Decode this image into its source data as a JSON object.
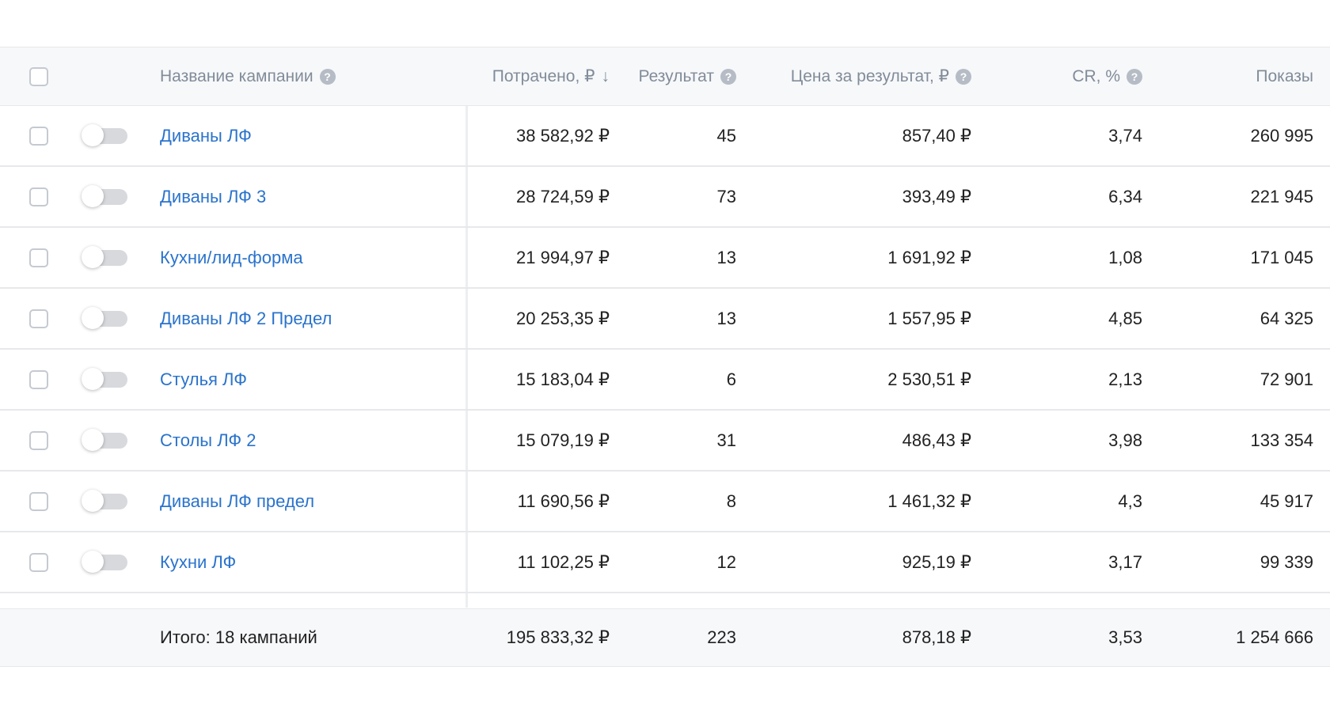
{
  "header": {
    "name": "Название кампании",
    "spent": "Потрачено, ₽",
    "result": "Результат",
    "price": "Цена за результат, ₽",
    "cr": "CR, %",
    "shows": "Показы",
    "sort_icon": "↓",
    "help_icon": "?"
  },
  "rows": [
    {
      "name": "Диваны ЛФ",
      "spent": "38 582,92 ₽",
      "result": "45",
      "price": "857,40 ₽",
      "cr": "3,74",
      "shows": "260 995"
    },
    {
      "name": "Диваны ЛФ 3",
      "spent": "28 724,59 ₽",
      "result": "73",
      "price": "393,49 ₽",
      "cr": "6,34",
      "shows": "221 945"
    },
    {
      "name": "Кухни/лид-форма",
      "spent": "21 994,97 ₽",
      "result": "13",
      "price": "1 691,92 ₽",
      "cr": "1,08",
      "shows": "171 045"
    },
    {
      "name": "Диваны ЛФ 2 Предел",
      "spent": "20 253,35 ₽",
      "result": "13",
      "price": "1 557,95 ₽",
      "cr": "4,85",
      "shows": "64 325"
    },
    {
      "name": "Стулья ЛФ",
      "spent": "15 183,04 ₽",
      "result": "6",
      "price": "2 530,51 ₽",
      "cr": "2,13",
      "shows": "72 901"
    },
    {
      "name": "Столы ЛФ 2",
      "spent": "15 079,19 ₽",
      "result": "31",
      "price": "486,43 ₽",
      "cr": "3,98",
      "shows": "133 354"
    },
    {
      "name": "Диваны ЛФ предел",
      "spent": "11 690,56 ₽",
      "result": "8",
      "price": "1 461,32 ₽",
      "cr": "4,3",
      "shows": "45 917"
    },
    {
      "name": "Кухни ЛФ",
      "spent": "11 102,25 ₽",
      "result": "12",
      "price": "925,19 ₽",
      "cr": "3,17",
      "shows": "99 339"
    }
  ],
  "footer": {
    "label": "Итого: 18 кампаний",
    "spent": "195 833,32 ₽",
    "result": "223",
    "price": "878,18 ₽",
    "cr": "3,53",
    "shows": "1 254 666"
  },
  "colors": {
    "link": "#2a73cc",
    "header_text": "#818c99",
    "header_bg": "#f7f8fa",
    "border": "#e7e8ec",
    "toggle_off": "#d7d9dd"
  },
  "icons": {
    "help": "question-circle-icon",
    "sort": "arrow-down-icon",
    "toggle": "toggle-switch-off"
  }
}
